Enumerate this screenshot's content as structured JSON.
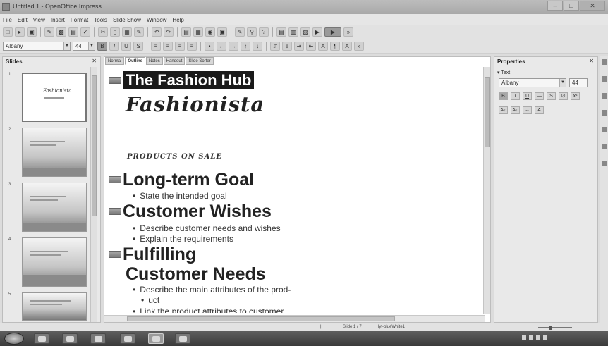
{
  "window": {
    "title": "Untitled 1 - OpenOffice Impress"
  },
  "menu": [
    "File",
    "Edit",
    "View",
    "Insert",
    "Format",
    "Tools",
    "Slide Show",
    "Window",
    "Help"
  ],
  "format_bar": {
    "font_name": "Albany",
    "font_size": "44"
  },
  "slides_panel": {
    "title": "Slides",
    "thumb_title": "Fashionista",
    "numbers": [
      "1",
      "2",
      "3",
      "4",
      "5"
    ]
  },
  "view_tabs": [
    "Normal",
    "Outline",
    "Notes",
    "Handout",
    "Slide Sorter"
  ],
  "outline": {
    "slide1_title": "The Fashion Hub",
    "slide1_subtitle": "Fashionista",
    "slide1_products": "PRODUCTS ON SALE",
    "slide2_title": "Long-term Goal",
    "slide2_b1": "State the intended goal",
    "slide3_title": "Customer Wishes",
    "slide3_b1": "Describe customer needs and wishes",
    "slide3_b2": "Explain the requirements",
    "slide4_title_l1": "Fulfilling",
    "slide4_title_l2": "Customer Needs",
    "slide4_b1_l1": "Describe the main attributes of the prod-",
    "slide4_b1_l2": "uct",
    "slide4_b2": "Link the product attributes to customer"
  },
  "properties": {
    "title": "Properties",
    "section": "Text",
    "font_name": "Albany",
    "font_size": "44"
  },
  "statusbar": {
    "slide_info": "Slide 1 / 7",
    "layout": "lyt-blueWhite1"
  },
  "icons": {
    "titlebar": "openoffice-icon",
    "taskbar": [
      "windows-start-icon",
      "explorer-icon",
      "media-icon",
      "ie-icon",
      "word-icon",
      "chrome-icon"
    ]
  }
}
